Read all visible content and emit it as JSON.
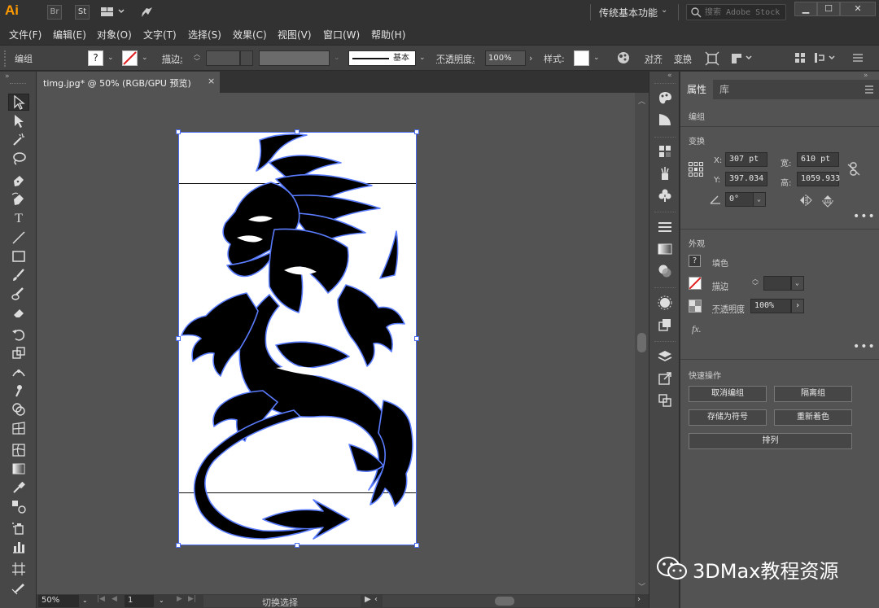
{
  "app": {
    "logo": "Ai",
    "bridge_label": "Br",
    "stock_label": "St",
    "workspace": "传统基本功能",
    "search_placeholder": "搜索 Adobe Stock"
  },
  "menu": [
    "文件(F)",
    "编辑(E)",
    "对象(O)",
    "文字(T)",
    "选择(S)",
    "效果(C)",
    "视图(V)",
    "窗口(W)",
    "帮助(H)"
  ],
  "control_bar": {
    "selection_label": "编组",
    "stroke_label": "描边:",
    "brush_label": "基本",
    "opacity_label": "不透明度:",
    "opacity_value": "100%",
    "style_label": "样式:",
    "align_label": "对齐",
    "transform_label": "变换"
  },
  "document": {
    "tab_title": "timg.jpg* @ 50% (RGB/GPU 预览)",
    "close_glyph": "×"
  },
  "status_bar": {
    "zoom": "50%",
    "artboard": "1",
    "action": "切换选择"
  },
  "properties": {
    "tab_properties": "属性",
    "tab_library": "库",
    "selection_type": "编组",
    "transform_header": "变换",
    "x_label": "X:",
    "x_value": "307 pt",
    "y_label": "Y:",
    "y_value": "397.034",
    "w_label": "宽:",
    "w_value": "610 pt",
    "h_label": "高:",
    "h_value": "1059.933",
    "angle_value": "0°",
    "appearance_header": "外观",
    "fill_label": "填色",
    "stroke_label": "描边",
    "opacity_label": "不透明度",
    "opacity_value": "100%",
    "fx_label": "fx.",
    "quick_actions_header": "快速操作",
    "btn_ungroup": "取消编组",
    "btn_isolate": "隔离组",
    "btn_save_symbol": "存储为符号",
    "btn_recolor": "重新着色",
    "btn_arrange": "排列",
    "more": "•••"
  },
  "watermark": "3DMax教程资源"
}
